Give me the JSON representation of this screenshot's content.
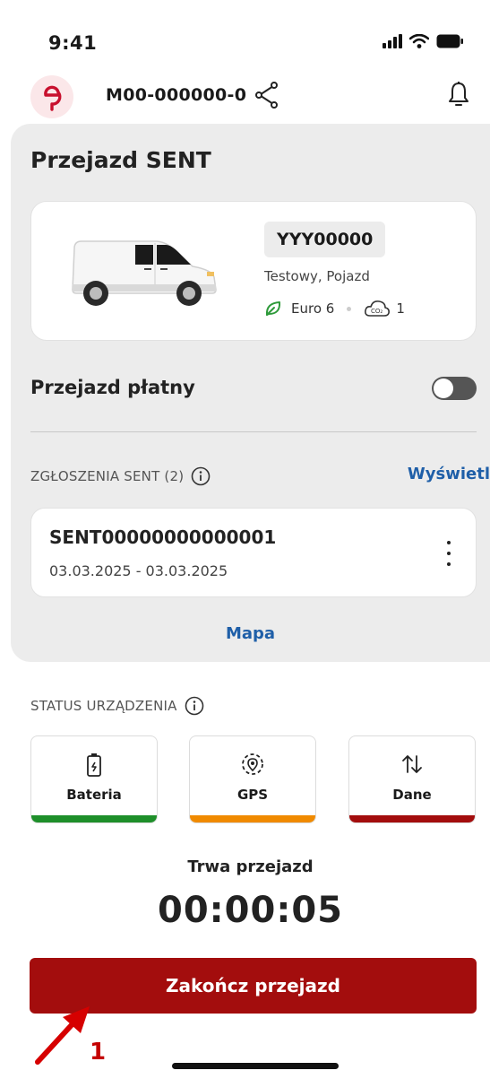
{
  "status_bar": {
    "time": "9:41"
  },
  "header": {
    "device_id": "M00-000000-0"
  },
  "trip": {
    "title": "Przejazd SENT"
  },
  "vehicle": {
    "plate": "YYY00000",
    "owner": "Testowy, Pojazd",
    "euro": "Euro 6",
    "co2_class": "1"
  },
  "paid_trip": {
    "label": "Przejazd płatny",
    "enabled": false
  },
  "sent_section": {
    "header": "ZGŁOSZENIA SENT (2)",
    "view_link": "Wyświetl",
    "card": {
      "id": "SENT00000000000001",
      "dates": "03.03.2025 - 03.03.2025"
    }
  },
  "map_link": "Mapa",
  "device_status": {
    "header": "STATUS URZĄDZENIA",
    "tiles": [
      {
        "label": "Bateria",
        "icon": "battery-icon",
        "color": "#1e8f2a"
      },
      {
        "label": "GPS",
        "icon": "gps-icon",
        "color": "#f08a00"
      },
      {
        "label": "Dane",
        "icon": "data-transfer-icon",
        "color": "#a30d0d"
      }
    ]
  },
  "timer": {
    "label": "Trwa przejazd",
    "value": "00:00:05"
  },
  "end_button": {
    "label": "Zakończ przejazd",
    "color": "#a30d0d"
  },
  "annotation": {
    "number": "1",
    "color": "#c40000"
  }
}
